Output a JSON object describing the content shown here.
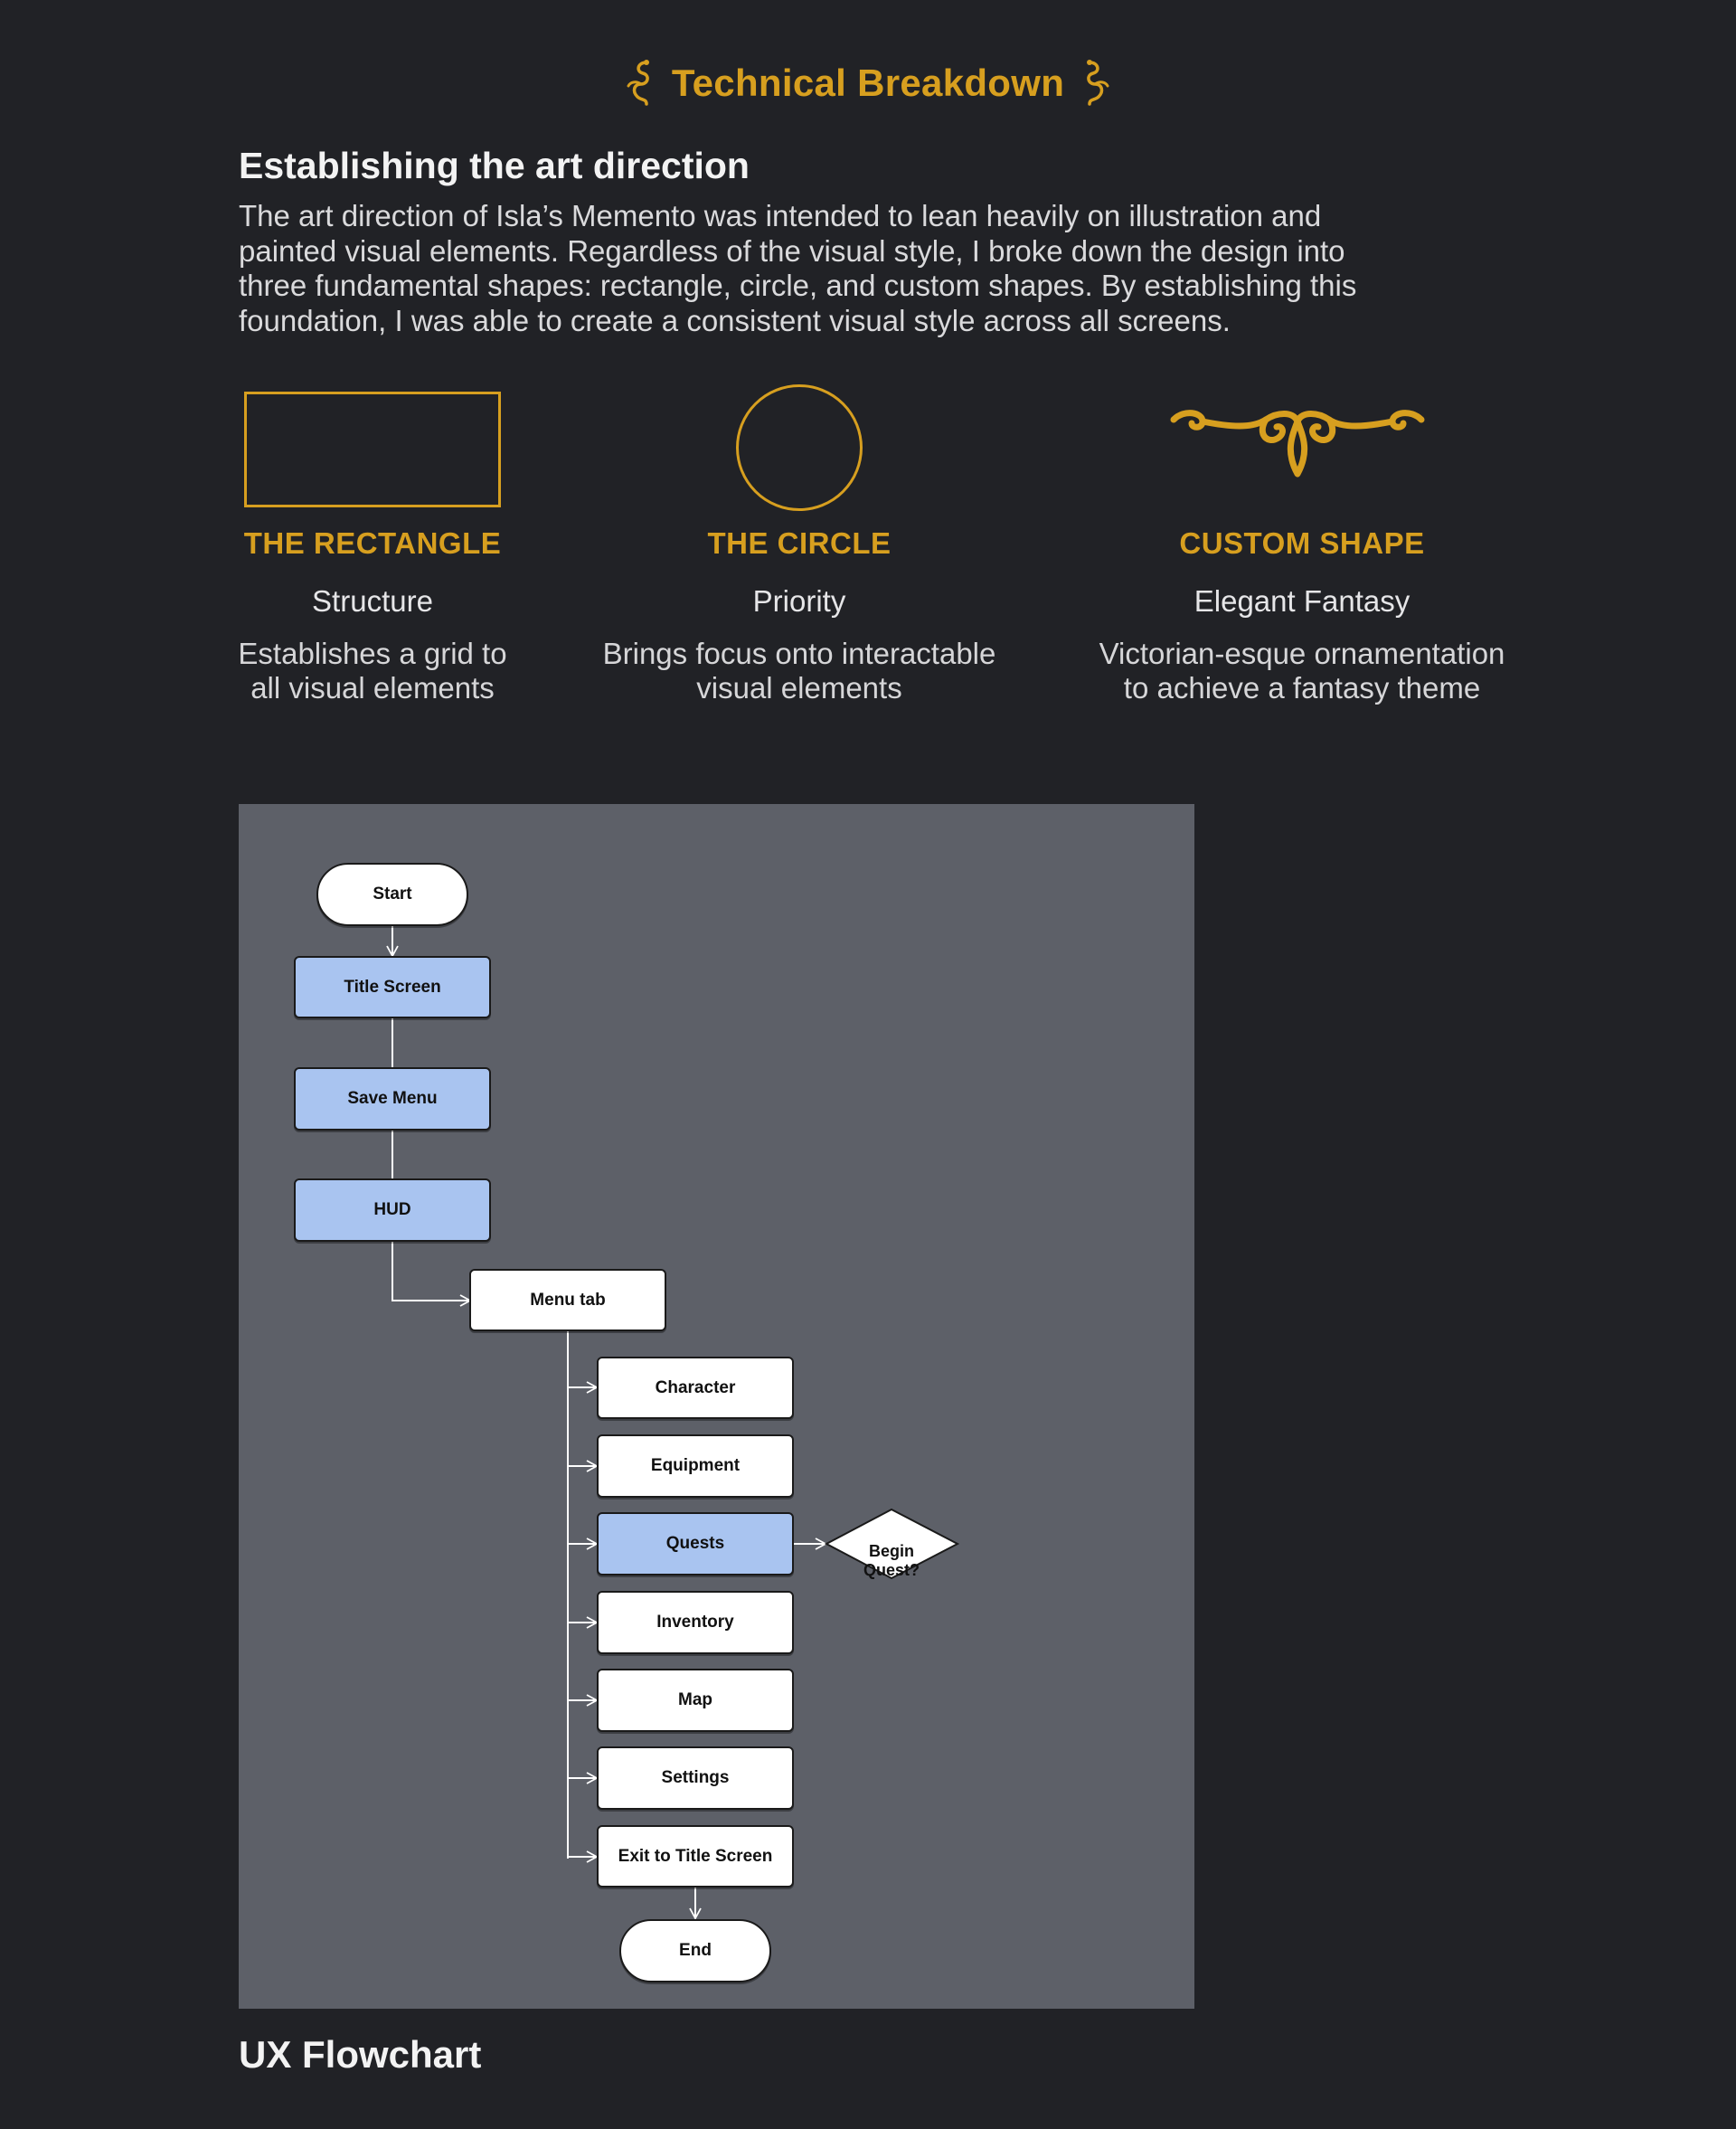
{
  "header": {
    "title": "Technical Breakdown"
  },
  "section": {
    "heading": "Establishing the art direction",
    "intro_lines": [
      "The art direction of Isla’s Memento was intended to lean heavily on illustration and",
      "painted visual elements. Regardless of the visual style, I broke down the design into",
      "three fundamental shapes: rectangle, circle, and custom shapes. By establishing this",
      "foundation, I was able to create a consistent visual style across all screens."
    ]
  },
  "shapes": [
    {
      "title": "THE RECTANGLE",
      "subtitle": "Structure",
      "desc_lines": [
        "Establishes a grid to",
        "all visual elements"
      ]
    },
    {
      "title": "THE CIRCLE",
      "subtitle": "Priority",
      "desc_lines": [
        "Brings focus onto interactable",
        "visual elements"
      ]
    },
    {
      "title": "CUSTOM SHAPE",
      "subtitle": "Elegant Fantasy",
      "desc_lines": [
        "Victorian-esque ornamentation",
        "to achieve a fantasy theme"
      ]
    }
  ],
  "flowchart": {
    "start": "Start",
    "title_screen": "Title Screen",
    "save_menu": "Save Menu",
    "hud": "HUD",
    "menu_tab": "Menu tab",
    "menu_items": [
      "Character",
      "Equipment",
      "Quests",
      "Inventory",
      "Map",
      "Settings",
      "Exit to Title Screen"
    ],
    "decision_lines": [
      "Begin",
      "Quest?"
    ],
    "end": "End"
  },
  "caption": "UX Flowchart",
  "colors": {
    "background": "#212226",
    "accent_gold": "#d79f1f",
    "panel": "#5d6068",
    "node_blue": "#a9c4f0",
    "node_white": "#ffffff"
  }
}
